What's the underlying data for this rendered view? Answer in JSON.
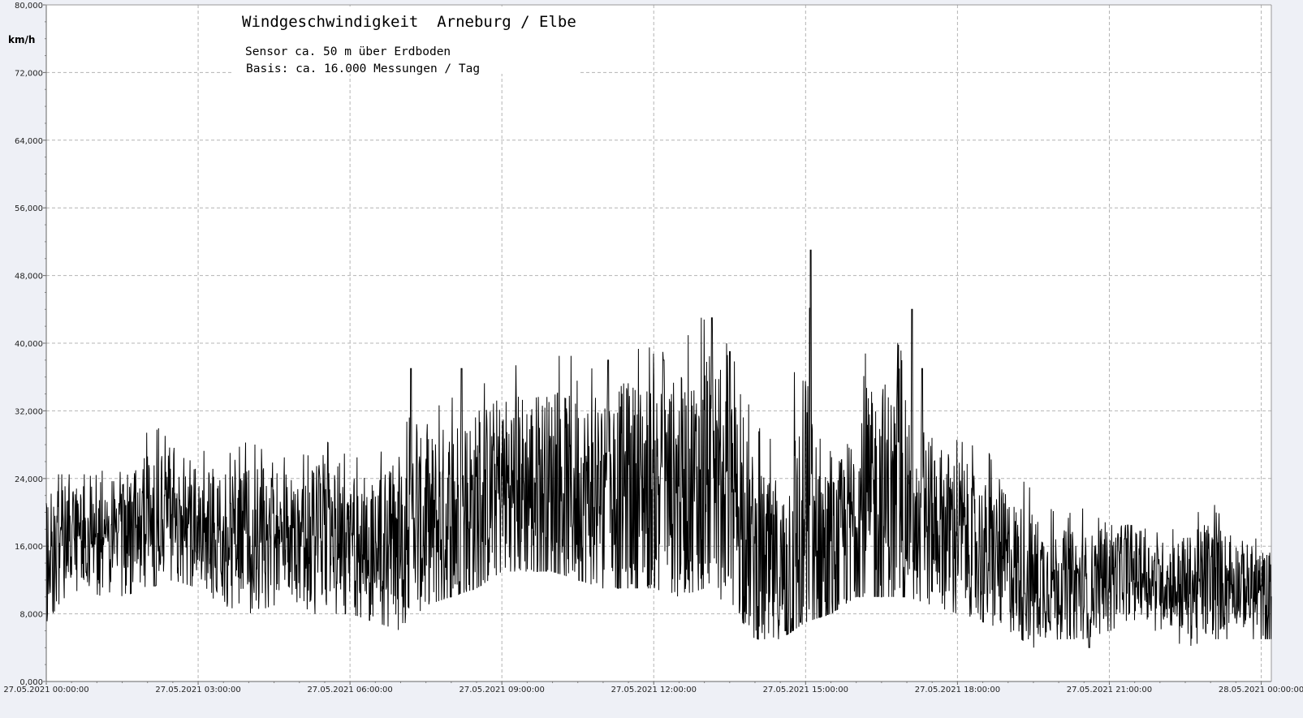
{
  "chart_data": {
    "type": "line",
    "title": "Windgeschwindigkeit  Arneburg / Elbe",
    "subtitle_lines": [
      "Sensor ca. 50 m über Erdboden",
      "Basis: ca. 16.000 Messungen / Tag"
    ],
    "ylabel": "km/h",
    "xlabel": "",
    "ylim": [
      0,
      80
    ],
    "y_ticks": [
      0,
      8,
      16,
      24,
      32,
      40,
      48,
      56,
      64,
      72,
      80
    ],
    "y_tick_labels": [
      "0,000",
      "8,000",
      "16,000",
      "24,000",
      "32,000",
      "40,000",
      "48,000",
      "56,000",
      "64,000",
      "72,000",
      "80,000"
    ],
    "x_unit": "hours since 27.05.2021 00:00",
    "xlim": [
      0,
      24.2
    ],
    "x_ticks": [
      0,
      3,
      6,
      9,
      12,
      15,
      18,
      21,
      24
    ],
    "x_tick_labels": [
      "27.05.2021  00:00:00",
      "27.05.2021  03:00:00",
      "27.05.2021  06:00:00",
      "27.05.2021  09:00:00",
      "27.05.2021  12:00:00",
      "27.05.2021  15:00:00",
      "27.05.2021  18:00:00",
      "27.05.2021  21:00:00",
      "28.05.2021  00:00:00"
    ],
    "grid": true,
    "legend": "none",
    "series": [
      {
        "color": "#000000",
        "x": [
          0.0,
          0.5,
          1.0,
          1.5,
          2.0,
          2.5,
          3.0,
          3.5,
          4.0,
          4.5,
          5.0,
          5.5,
          6.0,
          6.5,
          7.0,
          7.5,
          8.0,
          8.5,
          9.0,
          9.5,
          10.0,
          10.5,
          11.0,
          11.5,
          12.0,
          12.5,
          13.0,
          13.5,
          14.0,
          14.5,
          15.0,
          15.5,
          16.0,
          16.5,
          17.0,
          17.5,
          18.0,
          18.5,
          19.0,
          19.5,
          20.0,
          20.5,
          21.0,
          21.5,
          22.0,
          22.5,
          23.0,
          23.5,
          24.0
        ],
        "mean": [
          15,
          18,
          17,
          17,
          19,
          21,
          18,
          17,
          17,
          18,
          17,
          17,
          16,
          16,
          17,
          18,
          19,
          21,
          23,
          23,
          23,
          22,
          22,
          23,
          23,
          23,
          24,
          23,
          15,
          12,
          18,
          14,
          20,
          21,
          21,
          19,
          18,
          15,
          14,
          12,
          12,
          11,
          13,
          13,
          12,
          11,
          12,
          12,
          10
        ],
        "min": [
          8,
          12,
          9,
          11,
          12,
          13,
          12,
          10,
          9,
          10,
          9,
          9,
          9,
          8,
          7,
          10,
          11,
          12,
          14,
          14,
          14,
          13,
          12,
          12,
          12,
          11,
          12,
          10,
          6,
          6,
          8,
          9,
          11,
          11,
          11,
          10,
          9,
          8,
          7,
          5,
          6,
          6,
          7,
          7,
          7,
          5,
          6,
          6,
          6
        ],
        "max": [
          24,
          24,
          24,
          26,
          29,
          30,
          27,
          26,
          28,
          26,
          26,
          28,
          26,
          26,
          29,
          34,
          37,
          36,
          38,
          39,
          38,
          38,
          38,
          39,
          39,
          39,
          43,
          39,
          30,
          27,
          51,
          30,
          35,
          44,
          37,
          31,
          28,
          27,
          25,
          22,
          19,
          20,
          18,
          18,
          17,
          18,
          21,
          17,
          18
        ],
        "spikes": [
          {
            "x": 7.2,
            "y": 37
          },
          {
            "x": 8.2,
            "y": 37
          },
          {
            "x": 11.1,
            "y": 38
          },
          {
            "x": 12.2,
            "y": 38
          },
          {
            "x": 13.15,
            "y": 43
          },
          {
            "x": 13.5,
            "y": 39
          },
          {
            "x": 15.1,
            "y": 51
          },
          {
            "x": 17.1,
            "y": 44
          },
          {
            "x": 17.3,
            "y": 37
          },
          {
            "x": 14.9,
            "y": 7
          },
          {
            "x": 14.6,
            "y": 6
          },
          {
            "x": 20.6,
            "y": 4
          }
        ]
      }
    ]
  }
}
